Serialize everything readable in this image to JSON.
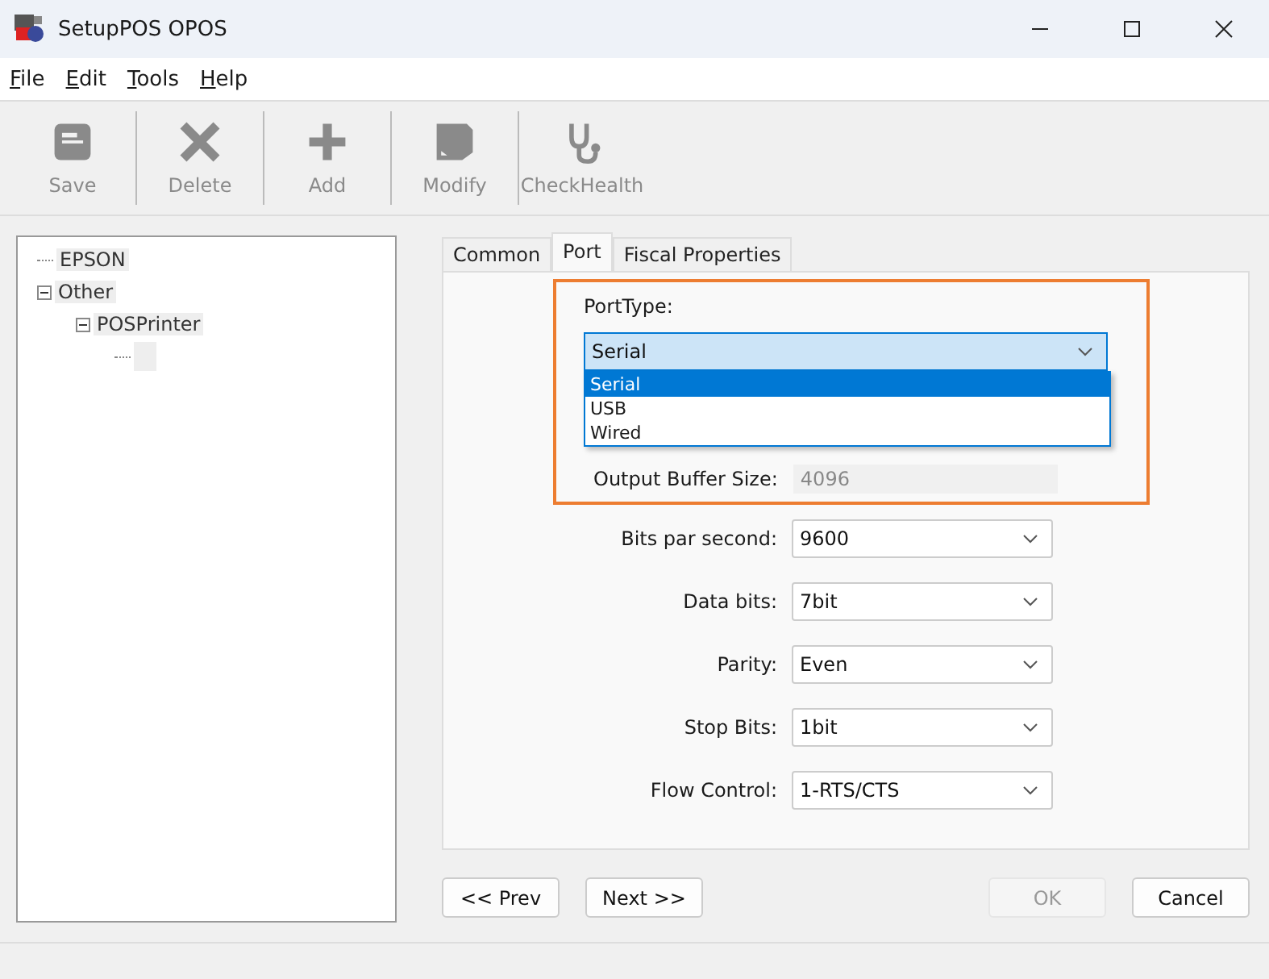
{
  "window": {
    "title": "SetupPOS OPOS"
  },
  "menu": [
    {
      "label": "File"
    },
    {
      "label": "Edit"
    },
    {
      "label": "Tools"
    },
    {
      "label": "Help"
    }
  ],
  "toolbar": [
    {
      "label": "Save",
      "kind": "save",
      "disabled": true
    },
    {
      "label": "Delete",
      "kind": "delete",
      "disabled": true
    },
    {
      "label": "Add",
      "kind": "add",
      "disabled": true
    },
    {
      "label": "Modify",
      "kind": "modify",
      "disabled": true
    },
    {
      "label": "CheckHealth",
      "kind": "health",
      "disabled": true
    }
  ],
  "tree": [
    {
      "label": "EPSON"
    },
    {
      "label": "Other",
      "expanded": true,
      "children": [
        {
          "label": "POSPrinter",
          "expanded": true
        }
      ]
    }
  ],
  "tabs": [
    {
      "label": "Common",
      "selected": false
    },
    {
      "label": "Port",
      "selected": true
    },
    {
      "label": "Fiscal Properties",
      "selected": false
    }
  ],
  "port_type": {
    "label": "PortType:",
    "value": "Serial",
    "open": true,
    "options": [
      {
        "label": "Serial",
        "selected": true
      },
      {
        "label": "USB",
        "selected": false
      },
      {
        "label": "Wired",
        "selected": false
      }
    ]
  },
  "output_buffer": {
    "label": "Output Buffer Size:",
    "value": "4096",
    "disabled": true
  },
  "settings": [
    {
      "label": "Bits par second:",
      "value": "9600"
    },
    {
      "label": "Data bits:",
      "value": "7bit"
    },
    {
      "label": "Parity:",
      "value": "Even"
    },
    {
      "label": "Stop Bits:",
      "value": "1bit"
    },
    {
      "label": "Flow Control:",
      "value": "1-RTS/CTS"
    }
  ],
  "buttons": [
    {
      "label": "<< Prev",
      "disabled": false
    },
    {
      "label": "Next >>",
      "disabled": false
    },
    {
      "label": "OK",
      "disabled": true
    },
    {
      "label": "Cancel",
      "disabled": false
    }
  ]
}
